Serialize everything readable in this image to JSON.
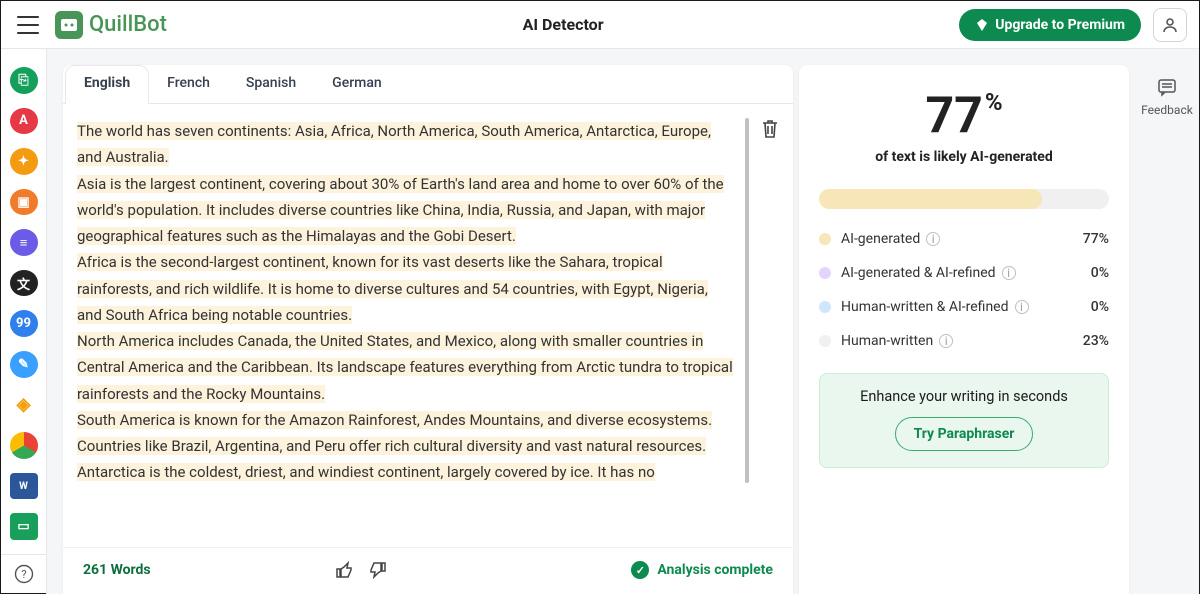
{
  "header": {
    "logo_text": "QuillBot",
    "app_title": "AI Detector",
    "upgrade_label": "Upgrade to Premium"
  },
  "tabs": {
    "items": [
      "English",
      "French",
      "Spanish",
      "German"
    ],
    "active_index": 0
  },
  "editor": {
    "text": "The world has seven continents: Asia, Africa, North America, South America, Antarctica, Europe, and Australia.\nAsia is the largest continent, covering about 30% of Earth's land area and home to over 60% of the world's population. It includes diverse countries like China, India, Russia, and Japan, with major geographical features such as the Himalayas and the Gobi Desert.\nAfrica is the second-largest continent, known for its vast deserts like the Sahara, tropical rainforests, and rich wildlife. It is home to diverse cultures and 54 countries, with Egypt, Nigeria, and South Africa being notable countries.\nNorth America includes Canada, the United States, and Mexico, along with smaller countries in Central America and the Caribbean. Its landscape features everything from Arctic tundra to tropical rainforests and the Rocky Mountains.\nSouth America is known for the Amazon Rainforest, Andes Mountains, and diverse ecosystems. Countries like Brazil, Argentina, and Peru offer rich cultural diversity and vast natural resources.\nAntarctica is the coldest, driest, and windiest continent, largely covered by ice. It has no"
  },
  "footer": {
    "word_count_label": "261 Words",
    "status_label": "Analysis complete"
  },
  "results": {
    "percent": "77",
    "percent_symbol": "%",
    "subtitle": "of text is likely AI-generated",
    "gauge_fill_percent": 77,
    "legend": [
      {
        "label": "AI-generated",
        "value": "77%",
        "color": "#f6e6b8"
      },
      {
        "label": "AI-generated & AI-refined",
        "value": "0%",
        "color": "#e5d4ff"
      },
      {
        "label": "Human-written & AI-refined",
        "value": "0%",
        "color": "#cfe6ff"
      },
      {
        "label": "Human-written",
        "value": "23%",
        "color": "#f0f0f0"
      }
    ]
  },
  "enhance": {
    "title": "Enhance your writing in seconds",
    "cta": "Try Paraphraser"
  },
  "feedback": {
    "label": "Feedback"
  },
  "sidebar_icons": [
    {
      "color": "#14a05a",
      "glyph": "⎘"
    },
    {
      "color": "#e63946",
      "glyph": "A"
    },
    {
      "color": "#f39c12",
      "glyph": "✦"
    },
    {
      "color": "#f07b2a",
      "glyph": "▣"
    },
    {
      "color": "#6b5ce7",
      "glyph": "≡"
    },
    {
      "color": "#222",
      "glyph": "文"
    },
    {
      "color": "#2f80ed",
      "glyph": "99"
    },
    {
      "color": "#3aa0ff",
      "glyph": "✎"
    }
  ]
}
